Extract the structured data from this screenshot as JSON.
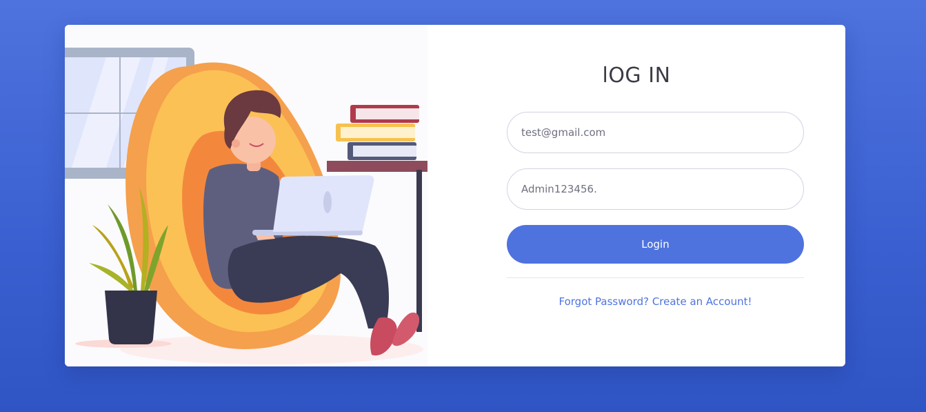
{
  "colors": {
    "background": "#4e73de",
    "card": "#ffffff",
    "primary": "#4e73df",
    "title_text": "#3a3b45",
    "input_text": "#6e707e",
    "input_border": "#d1d3e2"
  },
  "illustration": {
    "description_icon": "person-with-laptop-illustration"
  },
  "form": {
    "title": "lOG IN",
    "email_value": "test@gmail.com",
    "password_value": "Admin123456.",
    "login_label": "Login",
    "forgot_password_label": "Forgot Password?",
    "create_account_label": "Create an Account!"
  }
}
